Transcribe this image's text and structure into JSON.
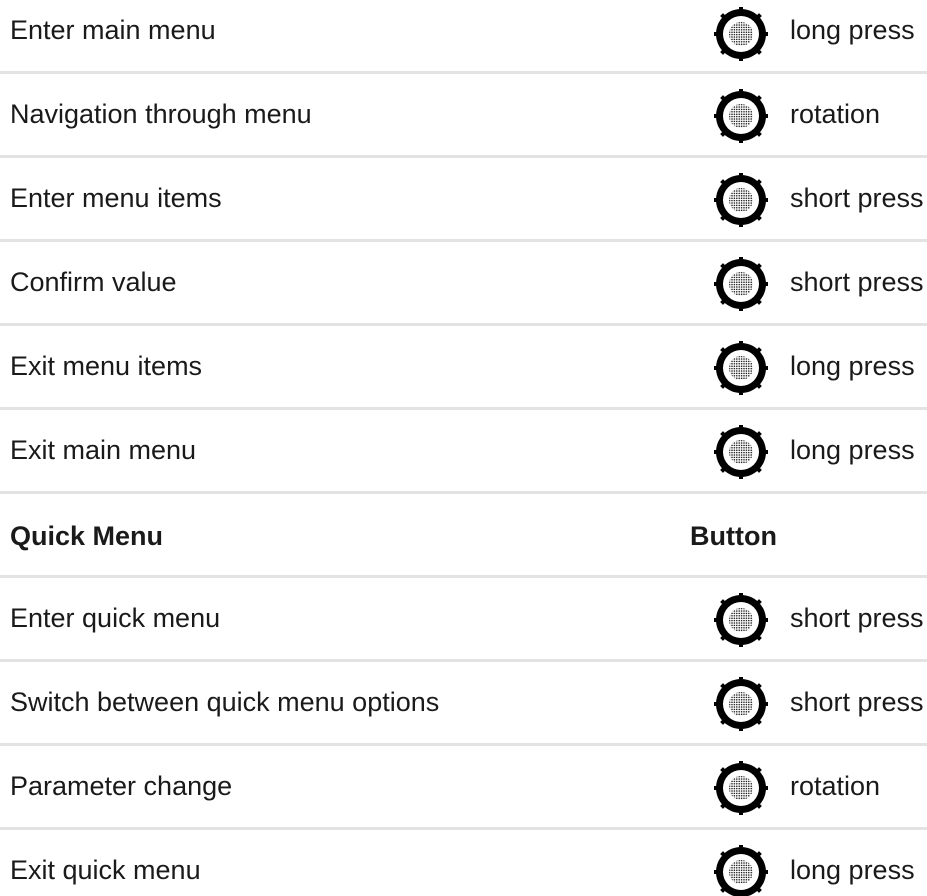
{
  "main_menu": {
    "rows": [
      {
        "action": "Enter main menu",
        "gesture": "long press"
      },
      {
        "action": "Navigation through menu",
        "gesture": "rotation"
      },
      {
        "action": "Enter menu items",
        "gesture": "short press"
      },
      {
        "action": "Confirm value",
        "gesture": "short press"
      },
      {
        "action": "Exit menu items",
        "gesture": "long press"
      },
      {
        "action": "Exit main menu",
        "gesture": "long press"
      }
    ]
  },
  "quick_menu": {
    "header": {
      "title": "Quick Menu",
      "column": "Button"
    },
    "rows": [
      {
        "action": "Enter quick menu",
        "gesture": "short press"
      },
      {
        "action": "Switch between quick menu options",
        "gesture": "short press"
      },
      {
        "action": "Parameter change",
        "gesture": "rotation"
      },
      {
        "action": "Exit quick menu",
        "gesture": "long press"
      }
    ]
  },
  "icons": {
    "control": "rotary-knob-icon"
  },
  "colors": {
    "text": "#1a1a1a",
    "divider": "#e3e3e3",
    "knob": "#000000"
  }
}
